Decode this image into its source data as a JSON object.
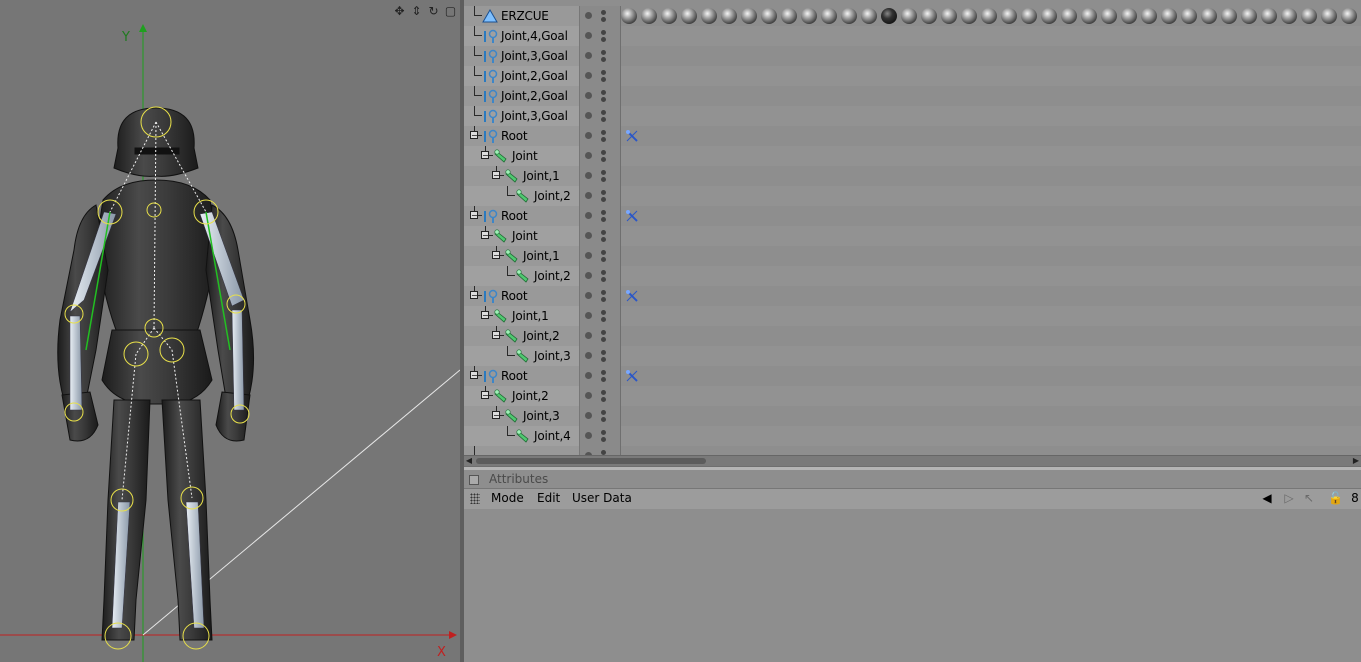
{
  "viewport": {
    "axis_y_label": "Y",
    "axis_x_label": "X",
    "nav_icons": [
      "move-icon",
      "zoom-icon",
      "rotate-icon",
      "maximize-icon"
    ],
    "nav_glyphs": [
      "✥",
      "⇕",
      "↻",
      "▢"
    ]
  },
  "object_manager": {
    "rows": [
      {
        "name": "ERZCUE",
        "depth": 0,
        "icon": "polygon-object-icon",
        "expander": "",
        "tag": "materials"
      },
      {
        "name": "Joint,4,Goal",
        "depth": 0,
        "icon": "ik-goal-icon",
        "expander": "",
        "tag": ""
      },
      {
        "name": "Joint,3,Goal",
        "depth": 0,
        "icon": "ik-goal-icon",
        "expander": "",
        "tag": ""
      },
      {
        "name": "Joint,2,Goal",
        "depth": 0,
        "icon": "ik-goal-icon",
        "expander": "",
        "tag": ""
      },
      {
        "name": "Joint,2,Goal",
        "depth": 0,
        "icon": "ik-goal-icon",
        "expander": "",
        "tag": ""
      },
      {
        "name": "Joint,3,Goal",
        "depth": 0,
        "icon": "ik-goal-icon",
        "expander": "",
        "tag": ""
      },
      {
        "name": "Root",
        "depth": 0,
        "icon": "ik-goal-icon",
        "expander": "−",
        "tag": "ik"
      },
      {
        "name": "Joint",
        "depth": 1,
        "icon": "bone-icon",
        "expander": "−",
        "tag": ""
      },
      {
        "name": "Joint,1",
        "depth": 2,
        "icon": "bone-icon",
        "expander": "−",
        "tag": ""
      },
      {
        "name": "Joint,2",
        "depth": 3,
        "icon": "bone-icon",
        "expander": "",
        "tag": ""
      },
      {
        "name": "Root",
        "depth": 0,
        "icon": "ik-goal-icon",
        "expander": "−",
        "tag": "ik"
      },
      {
        "name": "Joint",
        "depth": 1,
        "icon": "bone-icon",
        "expander": "−",
        "tag": ""
      },
      {
        "name": "Joint,1",
        "depth": 2,
        "icon": "bone-icon",
        "expander": "−",
        "tag": ""
      },
      {
        "name": "Joint,2",
        "depth": 3,
        "icon": "bone-icon",
        "expander": "",
        "tag": ""
      },
      {
        "name": "Root",
        "depth": 0,
        "icon": "ik-goal-icon",
        "expander": "−",
        "tag": "ik"
      },
      {
        "name": "Joint,1",
        "depth": 1,
        "icon": "bone-icon",
        "expander": "−",
        "tag": ""
      },
      {
        "name": "Joint,2",
        "depth": 2,
        "icon": "bone-icon",
        "expander": "−",
        "tag": ""
      },
      {
        "name": "Joint,3",
        "depth": 3,
        "icon": "bone-icon",
        "expander": "",
        "tag": ""
      },
      {
        "name": "Root",
        "depth": 0,
        "icon": "ik-goal-icon",
        "expander": "−",
        "tag": "ik"
      },
      {
        "name": "Joint,2",
        "depth": 1,
        "icon": "bone-icon",
        "expander": "−",
        "tag": ""
      },
      {
        "name": "Joint,3",
        "depth": 2,
        "icon": "bone-icon",
        "expander": "−",
        "tag": ""
      },
      {
        "name": "Joint,4",
        "depth": 3,
        "icon": "bone-icon",
        "expander": "",
        "tag": ""
      },
      {
        "name": "",
        "depth": 0,
        "icon": "",
        "expander": "",
        "tag": ""
      }
    ],
    "material_tag_count": 37,
    "active_material_index": 13,
    "scroll_left_glyph": "◀",
    "scroll_right_glyph": "▶"
  },
  "attributes": {
    "title": "Attributes",
    "menus": [
      "Mode",
      "Edit",
      "User Data"
    ],
    "tools": [
      {
        "name": "back-arrow-icon",
        "glyph": "◀"
      },
      {
        "name": "forward-arrow-icon",
        "glyph": "▷"
      },
      {
        "name": "pointer-icon",
        "glyph": "↖"
      },
      {
        "name": "lock-icon",
        "glyph": "🔓"
      },
      {
        "name": "more-icon",
        "glyph": "8"
      }
    ]
  }
}
